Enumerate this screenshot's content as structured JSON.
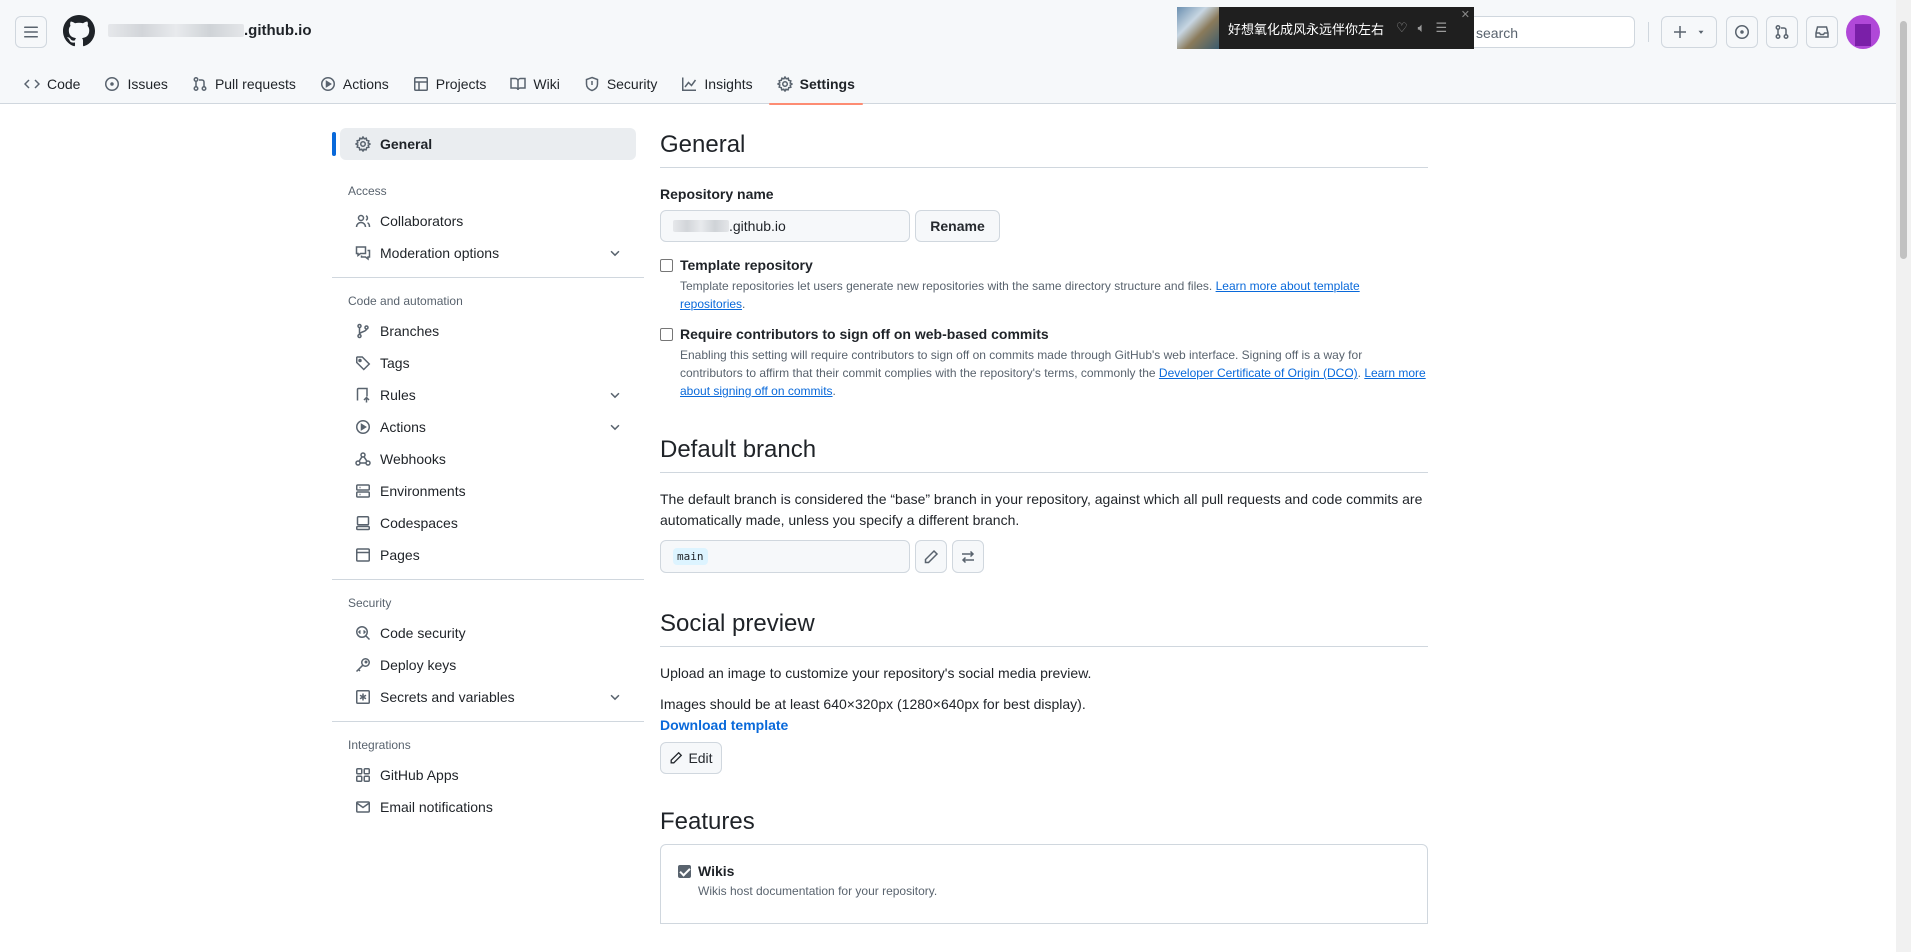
{
  "repo": {
    "name_suffix": ".github.io",
    "title_suffix": ".github.io"
  },
  "media_overlay": {
    "title": "好想氧化成风永远伴你左右",
    "close": "✕"
  },
  "search": {
    "placeholder": "search"
  },
  "tabs": [
    {
      "label": "Code",
      "icon": "code-icon"
    },
    {
      "label": "Issues",
      "icon": "issue-opened-icon"
    },
    {
      "label": "Pull requests",
      "icon": "git-pull-request-icon"
    },
    {
      "label": "Actions",
      "icon": "play-icon"
    },
    {
      "label": "Projects",
      "icon": "table-icon"
    },
    {
      "label": "Wiki",
      "icon": "book-icon"
    },
    {
      "label": "Security",
      "icon": "shield-icon"
    },
    {
      "label": "Insights",
      "icon": "graph-icon"
    },
    {
      "label": "Settings",
      "icon": "gear-icon",
      "selected": true
    }
  ],
  "sidebar": {
    "general": "General",
    "access_title": "Access",
    "access": [
      "Collaborators",
      "Moderation options"
    ],
    "code_title": "Code and automation",
    "code": [
      "Branches",
      "Tags",
      "Rules",
      "Actions",
      "Webhooks",
      "Environments",
      "Codespaces",
      "Pages"
    ],
    "security_title": "Security",
    "security": [
      "Code security",
      "Deploy keys",
      "Secrets and variables"
    ],
    "integrations_title": "Integrations",
    "integrations": [
      "GitHub Apps",
      "Email notifications"
    ]
  },
  "general": {
    "heading": "General",
    "repo_name_label": "Repository name",
    "rename_button": "Rename",
    "template": {
      "label": "Template repository",
      "note": "Template repositories let users generate new repositories with the same directory structure and files.",
      "link": "Learn more about template repositories",
      "checked": false
    },
    "signoff": {
      "label": "Require contributors to sign off on web-based commits",
      "note1": "Enabling this setting will require contributors to sign off on commits made through GitHub's web interface. Signing off is a way for contributors to affirm that their commit complies with the repository's terms, commonly the",
      "link1": "Developer Certificate of Origin (DCO)",
      "link2": "Learn more about signing off on commits",
      "checked": false
    }
  },
  "default_branch": {
    "heading": "Default branch",
    "description": "The default branch is considered the “base” branch in your repository, against which all pull requests and code commits are automatically made, unless you specify a different branch.",
    "branch": "main"
  },
  "social_preview": {
    "heading": "Social preview",
    "line1": "Upload an image to customize your repository's social media preview.",
    "line2": "Images should be at least 640×320px (1280×640px for best display).",
    "download": "Download template",
    "edit": "Edit"
  },
  "features": {
    "heading": "Features",
    "wikis_label": "Wikis",
    "wikis_note": "Wikis host documentation for your repository.",
    "wikis_checked": true
  },
  "colors": {
    "accent": "#0969da",
    "tab_underline": "#fd8c73",
    "header_bg": "#f6f8fa"
  }
}
